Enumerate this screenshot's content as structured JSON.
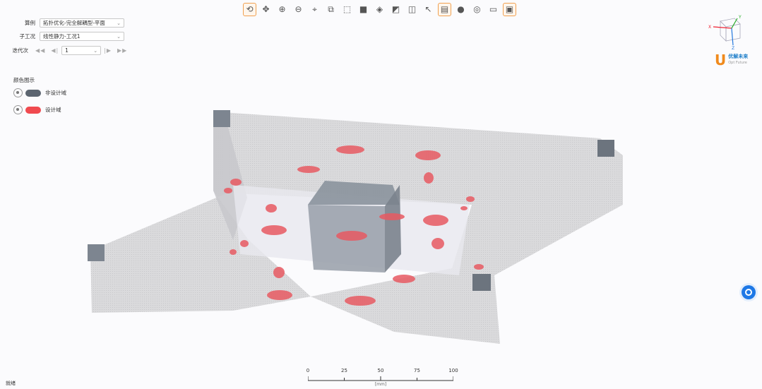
{
  "toolbar": {
    "icons": [
      {
        "name": "rotate-icon",
        "glyph": "⟲",
        "active": true
      },
      {
        "name": "pan-icon",
        "glyph": "✥",
        "active": false
      },
      {
        "name": "zoom-in-icon",
        "glyph": "⊕",
        "active": false
      },
      {
        "name": "zoom-out-icon",
        "glyph": "⊖",
        "active": false
      },
      {
        "name": "fit-view-icon",
        "glyph": "⌖",
        "active": false
      },
      {
        "name": "zoom-box-icon",
        "glyph": "⧉",
        "active": false
      },
      {
        "name": "box-select-icon",
        "glyph": "⬚",
        "active": false
      },
      {
        "name": "solid-cube-icon",
        "glyph": "■",
        "active": false
      },
      {
        "name": "wire-cube-icon",
        "glyph": "◈",
        "active": false
      },
      {
        "name": "section-icon",
        "glyph": "◩",
        "active": false
      },
      {
        "name": "clip-icon",
        "glyph": "◫",
        "active": false
      },
      {
        "name": "pick-icon",
        "glyph": "↖",
        "active": false
      },
      {
        "name": "mesh-icon",
        "glyph": "▤",
        "active": true
      },
      {
        "name": "shade-sphere-icon",
        "glyph": "●",
        "active": false
      },
      {
        "name": "lighting-icon",
        "glyph": "◎",
        "active": false
      },
      {
        "name": "split-view-icon",
        "glyph": "▭",
        "active": false
      },
      {
        "name": "frame-icon",
        "glyph": "▣",
        "active": true
      }
    ]
  },
  "controls": {
    "case_label": "算例",
    "case_value": "拓扑优化-完全解耦型-平面",
    "subcase_label": "子工况",
    "subcase_value": "线性静力-工况1",
    "iteration_label": "迭代次",
    "iteration_value": "1",
    "step_first": "◀◀",
    "step_prev": "◀|",
    "step_next": "|▶",
    "step_last": "▶▶"
  },
  "legend": {
    "title": "颜色图示",
    "items": [
      {
        "label": "非设计域",
        "color": "#5c6570"
      },
      {
        "label": "设计域",
        "color": "#f04a4f"
      }
    ]
  },
  "gizmo": {
    "x_label": "X",
    "y_label": "Y",
    "z_label": "Z"
  },
  "logo": {
    "brand": "优解未来",
    "sub": "Opt Future"
  },
  "scale_bar": {
    "ticks": [
      "0",
      "25",
      "50",
      "75",
      "100"
    ],
    "unit": "[mm]"
  },
  "status": {
    "text": "就绪"
  }
}
